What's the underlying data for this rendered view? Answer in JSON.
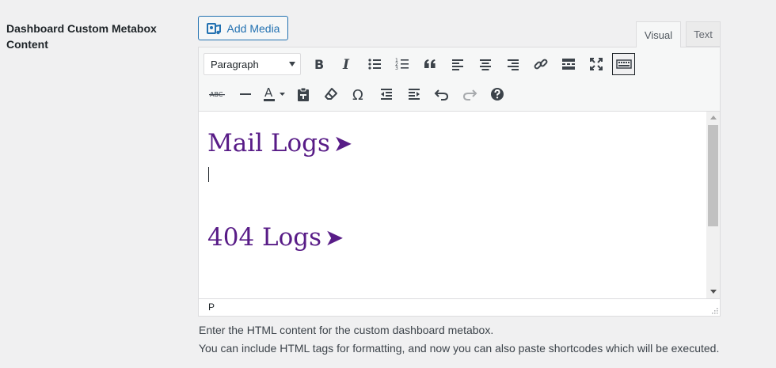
{
  "field": {
    "label": "Dashboard Custom Metabox Content"
  },
  "media": {
    "add_label": "Add Media"
  },
  "tabs": {
    "visual": "Visual",
    "text": "Text"
  },
  "toolbar": {
    "format_value": "Paragraph",
    "row1_icons": [
      "bold-icon",
      "italic-icon",
      "bullet-list-icon",
      "numbered-list-icon",
      "blockquote-icon",
      "align-left-icon",
      "align-center-icon",
      "align-right-icon",
      "link-icon",
      "read-more-icon",
      "fullscreen-icon",
      "toolbar-toggle-icon"
    ],
    "row2_icons": [
      "strikethrough-icon",
      "horizontal-line-icon",
      "text-color-icon",
      "paste-text-icon",
      "clear-formatting-icon",
      "special-character-icon",
      "outdent-icon",
      "indent-icon",
      "undo-icon",
      "redo-icon",
      "help-icon"
    ],
    "strike_text": "ABC",
    "color_letter": "A",
    "omega": "Ω"
  },
  "content": {
    "heading1": "Mail Logs",
    "heading2": "404 Logs",
    "arrow": "➤"
  },
  "status": {
    "path": "P"
  },
  "description": {
    "line1": "Enter the HTML content for the custom dashboard metabox.",
    "line2": "You can include HTML tags for formatting, and now you can also paste shortcodes which will be executed."
  },
  "colors": {
    "heading": "#581c87",
    "accent": "#2271b1"
  }
}
